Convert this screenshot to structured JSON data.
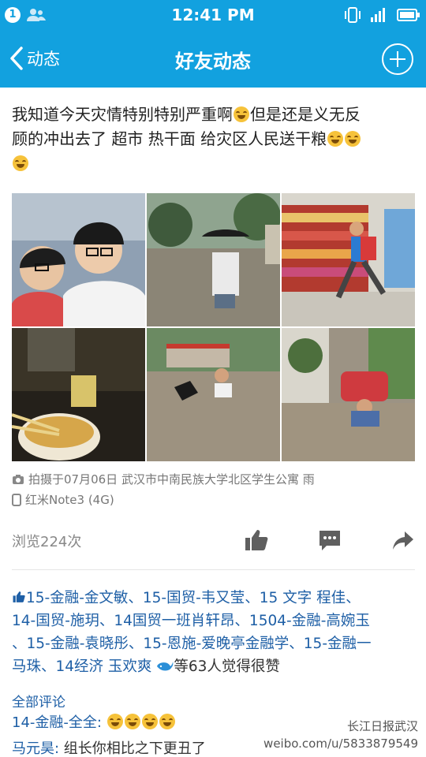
{
  "status_bar": {
    "badge": "1",
    "time": "12:41 PM"
  },
  "nav": {
    "back_label": "动态",
    "title": "好友动态"
  },
  "post": {
    "text_line1": "我知道今天灾情特别特别严重啊",
    "text_line1b": "但是还是义无反",
    "text_line2": "顾的冲出去了 超市 热干面  给灾区人民送干粮",
    "photo_meta": "拍摄于07月06日  武汉市中南民族大学北区学生公寓  雨",
    "device": "红米Note3 (4G)",
    "views": "浏览224次"
  },
  "likes": {
    "names_line1": "15-金融-金文敏、15-国贸-韦又莹、15 文字 程佳、",
    "names_line2": "14-国贸-施玥、14国贸一班肖轩昂、1504-金融-高婉玉",
    "names_line3": "、15-金融-袁晓彤、15-恩施-爱晚亭金融学、15-金融一",
    "names_line4": "马珠、14经济 玉欢爽",
    "suffix": "等63人觉得很赞"
  },
  "comments": {
    "header": "全部评论",
    "items": [
      {
        "author": "14-金融-全全:",
        "text": ""
      },
      {
        "author": "马元昊:",
        "text": " 组长你相比之下更丑了"
      }
    ]
  },
  "watermark": {
    "line1": "长江日报武汉",
    "line2": "weibo.com/u/5833879549"
  },
  "colors": {
    "accent": "#12a1df",
    "link": "#1e5fa6"
  }
}
